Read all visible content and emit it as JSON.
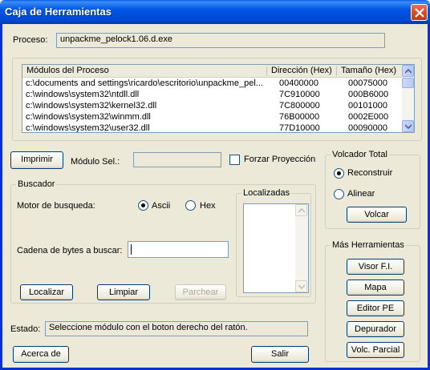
{
  "window": {
    "title": "Caja de Herramientas"
  },
  "proceso": {
    "label": "Proceso:",
    "value": "unpackme_pelock1.06.d.exe"
  },
  "modules": {
    "columns": [
      "Módulos del Proceso",
      "Dirección (Hex)",
      "Tamaño (Hex)"
    ],
    "rows": [
      [
        "c:\\documents and settings\\ricardo\\escritorio\\unpackme_pel...",
        "00400000",
        "00075000"
      ],
      [
        "c:\\windows\\system32\\ntdll.dll",
        "7C910000",
        "000B6000"
      ],
      [
        "c:\\windows\\system32\\kernel32.dll",
        "7C800000",
        "00101000"
      ],
      [
        "c:\\windows\\system32\\winmm.dll",
        "76B00000",
        "0002E000"
      ],
      [
        "c:\\windows\\system32\\user32.dll",
        "77D10000",
        "00090000"
      ]
    ]
  },
  "toolbar": {
    "imprimir": "Imprimir",
    "modulo_sel_label": "Módulo Sel.:",
    "modulo_sel_value": "",
    "forzar_proyeccion": "Forzar Proyección"
  },
  "buscador": {
    "legend": "Buscador",
    "motor_label": "Motor de busqueda:",
    "ascii": "Ascii",
    "hex": "Hex",
    "cadena_label": "Cadena de bytes a buscar:",
    "cadena_value": "",
    "localizadas": "Localizadas",
    "localizar": "Localizar",
    "limpiar": "Limpiar",
    "parchear": "Parchear"
  },
  "volcador": {
    "legend": "Volcador Total",
    "reconstruir": "Reconstruir",
    "alinear": "Alinear",
    "volcar": "Volcar"
  },
  "mas_herramientas": {
    "legend": "Más Herramientas",
    "buttons": [
      "Visor F.I.",
      "Mapa",
      "Editor PE",
      "Depurador",
      "Volc. Parcial"
    ]
  },
  "estado": {
    "label": "Estado:",
    "value": "Seleccione módulo con el boton derecho del ratón."
  },
  "footer": {
    "acerca": "Acerca de",
    "salir": "Salir"
  }
}
